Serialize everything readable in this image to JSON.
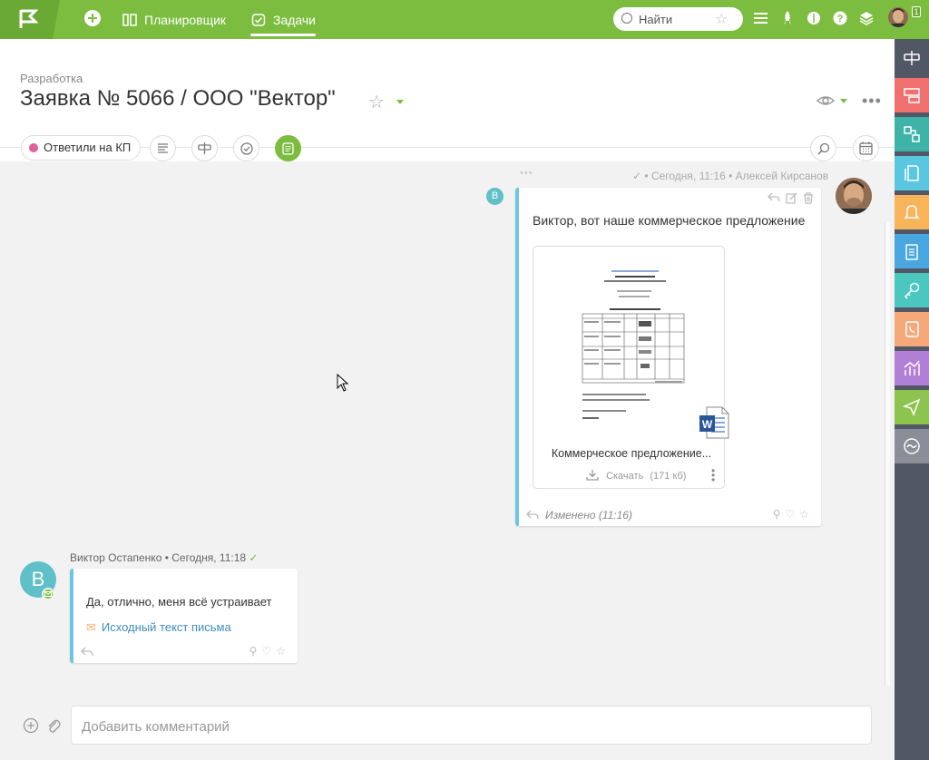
{
  "topbar": {
    "nav_planner": "Планировщик",
    "nav_tasks": "Задачи",
    "search_placeholder": "Найти",
    "badge_count": "1",
    "colors": {
      "green": "#7cbd40",
      "green_dark": "#6aa934"
    }
  },
  "header": {
    "breadcrumb": "Разработка",
    "title": "Заявка № 5066 / ООО \"Вектор\""
  },
  "toolbar": {
    "status_label": "Ответили на КП",
    "status_color": "#e0609a"
  },
  "feed": {
    "message1": {
      "meta": "• Сегодня, 11:16 • Алексей Кирсанов",
      "author_initial": "В",
      "text": "Виктор, вот наше коммерческое предложение",
      "attachment": {
        "name": "Коммерческое предложение...",
        "download_label": "Скачать",
        "size": "(171 кб)",
        "icon": "word-document-icon"
      },
      "edited": "Изменено (11:16)"
    },
    "message2": {
      "author": "Виктор Остапенко",
      "time": "Сегодня, 11:18",
      "author_initial": "В",
      "text": "Да, отлично, меня всё устраивает",
      "mail_link": "Исходный текст письма"
    }
  },
  "comment": {
    "placeholder": "Добавить комментарий"
  },
  "rail": {
    "items": [
      {
        "icon": "signpost-icon",
        "color": "#525766"
      },
      {
        "icon": "chat-board-icon",
        "color": "#f06f6f"
      },
      {
        "icon": "flow-icon",
        "color": "#3fb3a8"
      },
      {
        "icon": "files-icon",
        "color": "#5bc6e0"
      },
      {
        "icon": "bell-icon",
        "color": "#f7b45a"
      },
      {
        "icon": "clipboard-icon",
        "color": "#4aa6de"
      },
      {
        "icon": "key-icon",
        "color": "#4cc7c0"
      },
      {
        "icon": "phone-book-icon",
        "color": "#f5a87a"
      },
      {
        "icon": "chart-icon",
        "color": "#b27fd6"
      },
      {
        "icon": "send-icon",
        "color": "#8dc44f"
      },
      {
        "icon": "wave-icon",
        "color": "#8a8e99"
      }
    ]
  }
}
